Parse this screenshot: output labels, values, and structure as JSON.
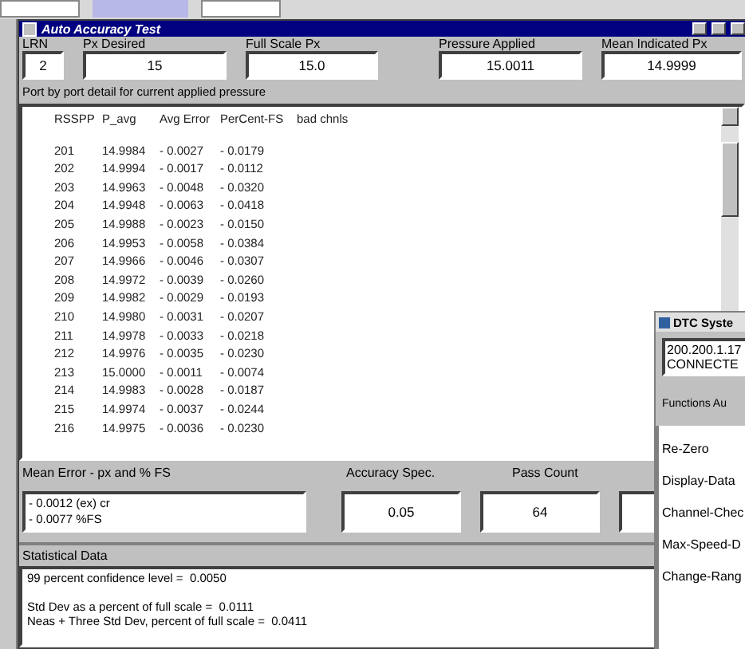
{
  "window": {
    "title": "Auto Accuracy Test"
  },
  "fields": [
    {
      "label": "LRN",
      "value": "2"
    },
    {
      "label": "Px Desired",
      "value": "15"
    },
    {
      "label": "Full Scale Px",
      "value": "15.0"
    },
    {
      "label": "Pressure Applied",
      "value": "15.0011"
    },
    {
      "label": "Mean Indicated Px",
      "value": "14.9999"
    }
  ],
  "detail_label": "Port by port detail for current applied pressure",
  "detail": {
    "columns": [
      "RSSPP",
      "P_avg",
      "Avg Error",
      "PerCent-FS",
      "bad chnls"
    ],
    "rows": [
      [
        "201",
        "14.9984",
        "- 0.0027",
        "- 0.0179"
      ],
      [
        "202",
        "14.9994",
        "- 0.0017",
        "- 0.0112"
      ],
      [
        "203",
        "14.9963",
        "- 0.0048",
        "- 0.0320"
      ],
      [
        "204",
        "14.9948",
        "- 0.0063",
        "- 0.0418"
      ],
      [
        "205",
        "14.9988",
        "- 0.0023",
        "- 0.0150"
      ],
      [
        "206",
        "14.9953",
        "- 0.0058",
        "- 0.0384"
      ],
      [
        "207",
        "14.9966",
        "- 0.0046",
        "- 0.0307"
      ],
      [
        "208",
        "14.9972",
        "- 0.0039",
        "- 0.0260"
      ],
      [
        "209",
        "14.9982",
        "- 0.0029",
        "- 0.0193"
      ],
      [
        "210",
        "14.9980",
        "- 0.0031",
        "- 0.0207"
      ],
      [
        "211",
        "14.9978",
        "- 0.0033",
        "- 0.0218"
      ],
      [
        "212",
        "14.9976",
        "- 0.0035",
        "- 0.0230"
      ],
      [
        "213",
        "15.0000",
        "- 0.0011",
        "- 0.0074"
      ],
      [
        "214",
        "14.9983",
        "- 0.0028",
        "- 0.0187"
      ],
      [
        "215",
        "14.9974",
        "- 0.0037",
        "- 0.0244"
      ],
      [
        "216",
        "14.9975",
        "- 0.0036",
        "- 0.0230"
      ]
    ]
  },
  "mean_error": {
    "label": "Mean Error - px and % FS",
    "lines": [
      "- 0.0012  (ex) cr",
      "- 0.0077  %FS"
    ]
  },
  "accuracy_spec": {
    "label": "Accuracy Spec.",
    "value": "0.05"
  },
  "pass_count": {
    "label": "Pass Count",
    "value": "64"
  },
  "statistics": {
    "label": "Statistical Data",
    "lines": [
      "99 percent confidence level =  0.0050",
      "Std Dev as a percent of full scale =  0.0111",
      "Neas + Three Std Dev, percent of full scale =  0.0411"
    ]
  },
  "dtc_window": {
    "title": "DTC Syste",
    "address": "200.200.1.17",
    "status": "CONNECTE",
    "functions_label": "Functions Au",
    "functions": [
      "Re-Zero",
      "Display-Data",
      "Channel-Chec",
      "Max-Speed-D",
      "Change-Rang"
    ]
  }
}
